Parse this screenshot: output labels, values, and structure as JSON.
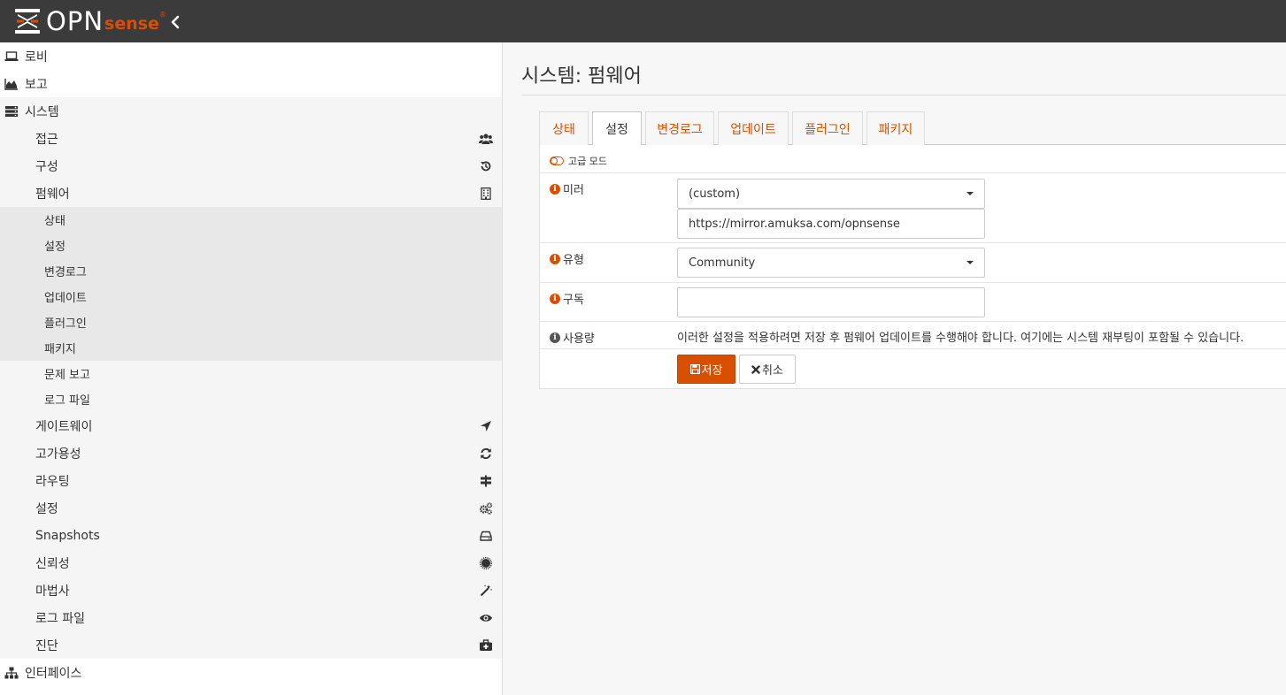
{
  "brand": {
    "name": "OPN",
    "sense": "sense",
    "reg": "®"
  },
  "sidebar": {
    "top_items": [
      {
        "label": "로비",
        "icon": "laptop-icon"
      },
      {
        "label": "보고",
        "icon": "area-chart-icon"
      },
      {
        "label": "시스템",
        "icon": "server-icon"
      },
      {
        "label": "인터페이스",
        "icon": "sitemap-icon"
      }
    ],
    "system_items": [
      {
        "label": "접근",
        "icon": "users-icon"
      },
      {
        "label": "구성",
        "icon": "history-icon"
      },
      {
        "label": "펌웨어",
        "icon": "building-icon"
      },
      {
        "label": "게이트웨이",
        "icon": "location-arrow-icon"
      },
      {
        "label": "고가용성",
        "icon": "refresh-icon"
      },
      {
        "label": "라우팅",
        "icon": "map-signs-icon"
      },
      {
        "label": "설정",
        "icon": "cogs-icon"
      },
      {
        "label": "Snapshots",
        "icon": "hdd-icon"
      },
      {
        "label": "신뢰성",
        "icon": "certificate-icon"
      },
      {
        "label": "마법사",
        "icon": "magic-icon"
      },
      {
        "label": "로그 파일",
        "icon": "eye-icon"
      },
      {
        "label": "진단",
        "icon": "medkit-icon"
      }
    ],
    "firmware_items": [
      {
        "label": "상태"
      },
      {
        "label": "설정"
      },
      {
        "label": "변경로그"
      },
      {
        "label": "업데이트"
      },
      {
        "label": "플러그인"
      },
      {
        "label": "패키지"
      },
      {
        "label": "문제 보고"
      },
      {
        "label": "로그 파일"
      }
    ]
  },
  "main": {
    "title": "시스템: 펌웨어",
    "tabs": [
      "상태",
      "설정",
      "변경로그",
      "업데이트",
      "플러그인",
      "패키지"
    ],
    "active_tab": "설정",
    "advanced_mode": "고급 모드",
    "form": {
      "mirror_label": "미러",
      "mirror_value": "(custom)",
      "mirror_url": "https://mirror.amuksa.com/opnsense",
      "type_label": "유형",
      "type_value": "Community",
      "subscription_label": "구독",
      "subscription_value": "",
      "usage_label": "사용량",
      "usage_text": "이러한 설정을 적용하려면 저장 후 펌웨어 업데이트를 수행해야 합니다. 여기에는 시스템 재부팅이 포함될 수 있습니다.",
      "save_label": "저장",
      "cancel_label": "취소"
    }
  },
  "colors": {
    "accent": "#d94f00",
    "topbar": "#3b3b3b"
  }
}
